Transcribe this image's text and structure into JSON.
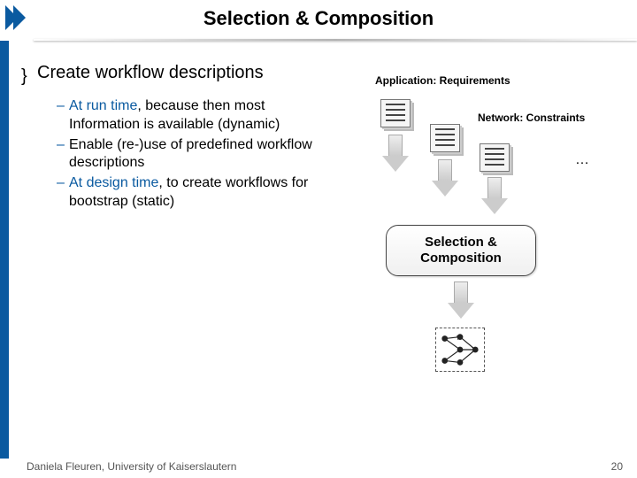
{
  "title": "Selection & Composition",
  "main": {
    "heading": "Create workflow descriptions",
    "items": [
      {
        "accent": "At run time",
        "rest": ", because then most Information is available (dynamic)"
      },
      {
        "accent": "",
        "rest": "Enable (re-)use of predefined workflow descriptions"
      },
      {
        "accent": "At design time",
        "rest": ", to create workflows for bootstrap (static)"
      }
    ]
  },
  "diagram": {
    "label_app": "Application: Requirements",
    "label_net": "Network: Constraints",
    "ellipsis": "…",
    "box": "Selection & Composition"
  },
  "footer": {
    "author": "Daniela Fleuren, University of  Kaiserslautern",
    "page": "20"
  }
}
